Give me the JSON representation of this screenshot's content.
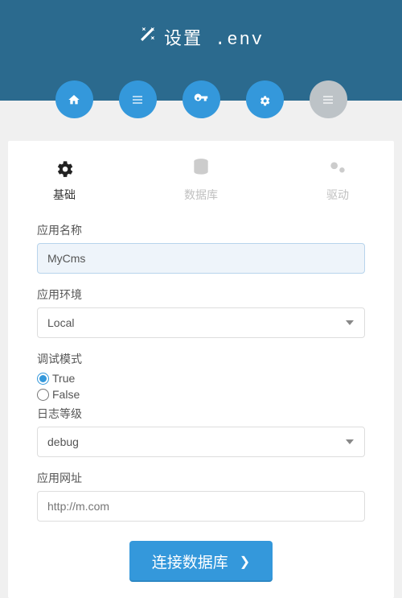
{
  "header": {
    "title": "设置 .env"
  },
  "navCircles": [
    {
      "name": "home",
      "disabled": false
    },
    {
      "name": "list",
      "disabled": false
    },
    {
      "name": "key",
      "disabled": false
    },
    {
      "name": "gear",
      "disabled": false
    },
    {
      "name": "lines",
      "disabled": true
    }
  ],
  "tabs": {
    "basic": {
      "label": "基础",
      "active": true
    },
    "database": {
      "label": "数据库",
      "active": false
    },
    "driver": {
      "label": "驱动",
      "active": false
    }
  },
  "form": {
    "appName": {
      "label": "应用名称",
      "value": "MyCms"
    },
    "appEnv": {
      "label": "应用环境",
      "value": "Local"
    },
    "debugMode": {
      "label": "调试模式",
      "trueLabel": "True",
      "falseLabel": "False",
      "selected": "true"
    },
    "logLevel": {
      "label": "日志等级",
      "value": "debug"
    },
    "appUrl": {
      "label": "应用网址",
      "placeholder": "http://m.com",
      "value": ""
    }
  },
  "button": {
    "label": "连接数据库"
  }
}
